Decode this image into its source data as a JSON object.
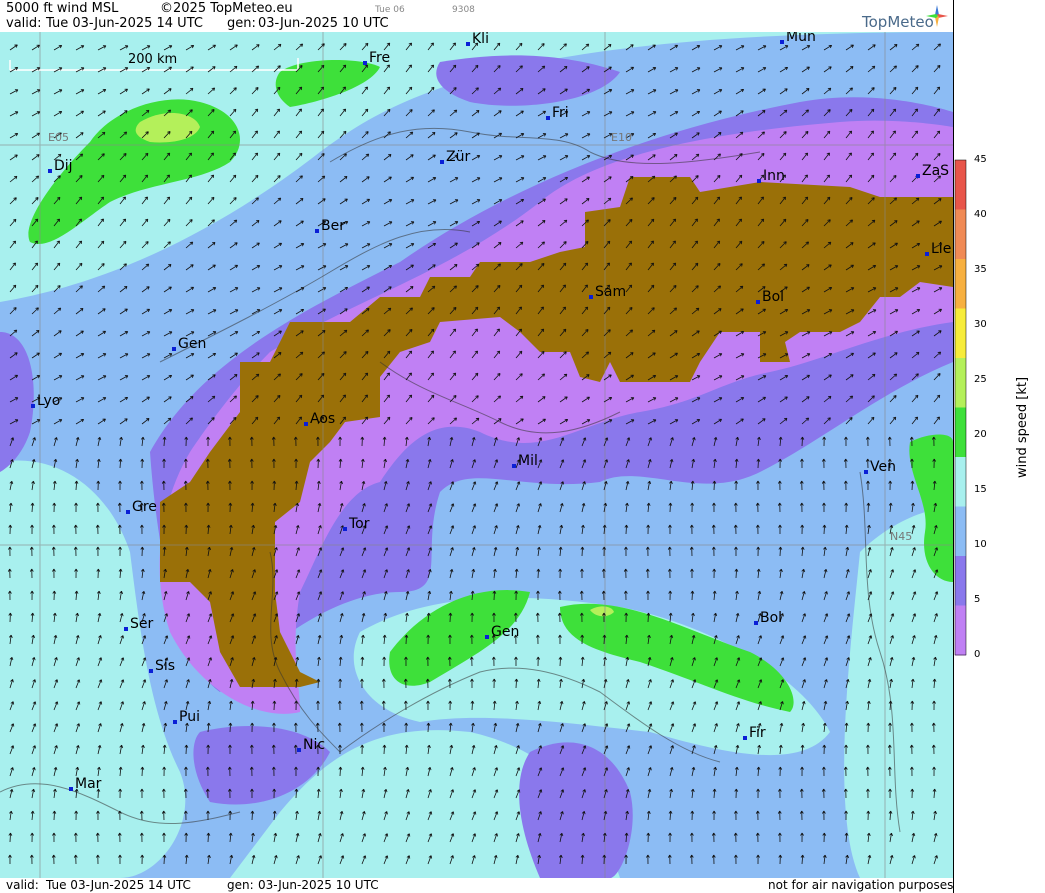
{
  "header": {
    "title": "5000 ft wind MSL",
    "copyright": "©2025 TopMeteo.eu",
    "day_code": "Tue 06",
    "run_code": "9308",
    "valid_label": "valid:",
    "valid_value": "Tue  03-Jun-2025  14 UTC",
    "gen_label": "gen:",
    "gen_value": "03-Jun-2025 10 UTC",
    "brand": "TopMeteo"
  },
  "map": {
    "scale_label": "200 km",
    "grid_labels": [
      "E05",
      "E10",
      "N45"
    ],
    "cities": [
      {
        "name": "Kli"
      },
      {
        "name": "Mun"
      },
      {
        "name": "Fre"
      },
      {
        "name": "Fri"
      },
      {
        "name": "Dij"
      },
      {
        "name": "Zür"
      },
      {
        "name": "Inn"
      },
      {
        "name": "ZaS"
      },
      {
        "name": "Ber"
      },
      {
        "name": "Lie"
      },
      {
        "name": "Sam"
      },
      {
        "name": "Bol"
      },
      {
        "name": "Gen"
      },
      {
        "name": "Lyo"
      },
      {
        "name": "Aos"
      },
      {
        "name": "Mil"
      },
      {
        "name": "Ven"
      },
      {
        "name": "Gre"
      },
      {
        "name": "Tor"
      },
      {
        "name": "Ser"
      },
      {
        "name": "Gen"
      },
      {
        "name": "Bol"
      },
      {
        "name": "Sis"
      },
      {
        "name": "Pui"
      },
      {
        "name": "Nic"
      },
      {
        "name": "Fir"
      },
      {
        "name": "Mar"
      }
    ]
  },
  "footer": {
    "valid_label": "valid:",
    "valid_value": "Tue  03-Jun-2025  14 UTC",
    "gen_label": "gen:",
    "gen_value": "03-Jun-2025 10 UTC",
    "disclaimer": "not for air navigation purposes"
  },
  "legend": {
    "title": "wind speed [kt]",
    "ticks": [
      "45",
      "40",
      "35",
      "30",
      "25",
      "20",
      "15",
      "10",
      "5",
      "0"
    ],
    "colors": [
      "#e8554a",
      "#f08a55",
      "#f7b040",
      "#f7ec3a",
      "#b4f05a",
      "#3ee03a",
      "#a8f0ee",
      "#8cbcf4",
      "#8a78ec",
      "#c080f4"
    ],
    "terrain_color": "#9a7008"
  }
}
